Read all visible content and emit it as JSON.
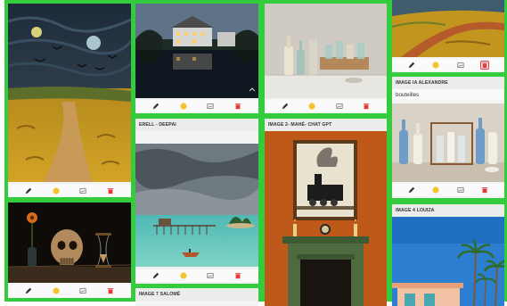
{
  "colors": {
    "board_green": "#33cc3d",
    "toolbar_bg": "#fafafa",
    "title_bg": "#ececec",
    "pencil": "#333333",
    "emoji": "#f4c430",
    "image_icon": "#777777",
    "trash": "#e53935"
  },
  "toolbar_icons": [
    "pencil-icon",
    "smiley-icon",
    "image-icon",
    "trash-icon"
  ],
  "cards": {
    "erell": {
      "title": "ERELL - DEEPAI"
    },
    "mahe": {
      "title": "IMAGE 2- MAHÉ- CHAT GPT"
    },
    "alexandre": {
      "title": "IMAGE IA ALEXANDRE",
      "subtitle": "bouteilles"
    },
    "louiza": {
      "title": "IMAGE 4 LOUIZA"
    },
    "salome": {
      "title": "IMAGE 7 SALOMÉ"
    }
  }
}
